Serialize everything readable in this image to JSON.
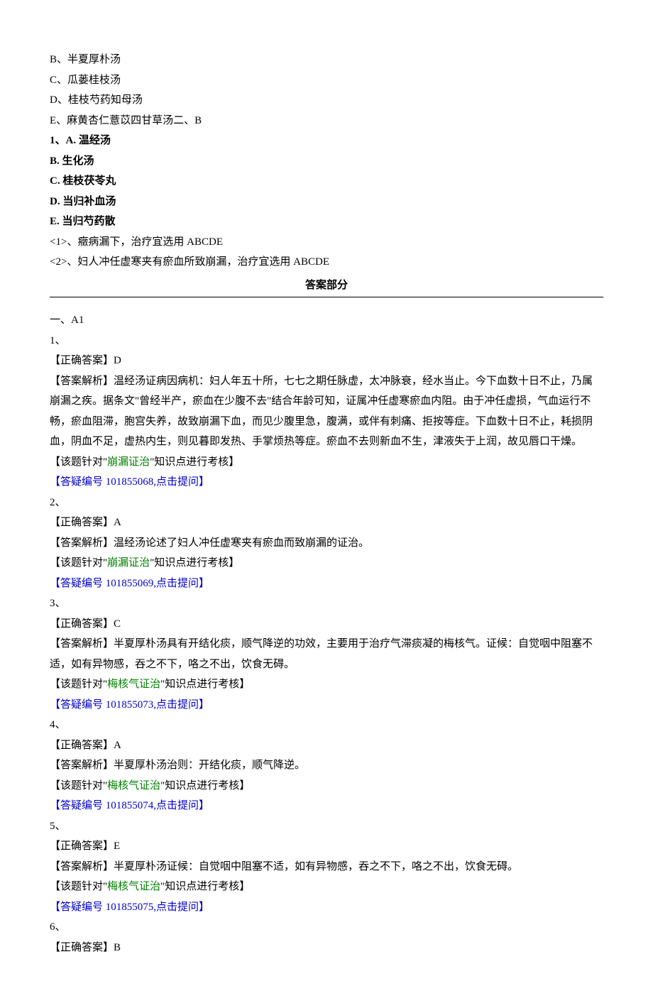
{
  "options_top": {
    "B": "B、半夏厚朴汤",
    "C": "C、瓜蒌桂枝汤",
    "D": "D、桂枝芍药知母汤",
    "E": "E、麻黄杏仁薏苡四甘草汤二、B"
  },
  "q1": {
    "num": "1、A. 温经汤",
    "B": "B. 生化汤",
    "C": "C. 桂枝茯苓丸",
    "D": "D. 当归补血汤",
    "E": "E. 当归芍药散",
    "sub1": "<1>、癥病漏下，治疗宜选用 ABCDE",
    "sub2": "<2>、妇人冲任虚寒夹有瘀血所致崩漏，治疗宜选用 ABCDE"
  },
  "answer_title": "答案部分",
  "section": "一、A1",
  "answers": [
    {
      "num": "1、",
      "correct_label": "【正确答案】",
      "correct_val": "D",
      "analysis_label": "【答案解析】",
      "analysis": "温经汤证病因病机：妇人年五十所，七七之期任脉虚，太冲脉衰，经水当止。今下血数十日不止，乃属崩漏之疾。据条文\"曾经半产，瘀血在少腹不去\"结合年龄可知，证属冲任虚寒瘀血内阻。由于冲任虚损，气血运行不畅，瘀血阻滞，胞宫失养，故致崩漏下血，而见少腹里急，腹满，或伴有刺痛、拒按等症。下血数十日不止，耗损阴血，阴血不足，虚热内生，则见暮即发热、手掌烦热等症。瘀血不去则新血不生，津液失于上润，故见唇口干燥。",
      "point_pre": "【该题针对\"",
      "point_topic": "崩漏证治",
      "point_post": "\"知识点进行考核】",
      "faq_pre": "【答疑编号 ",
      "faq_id": "101855068",
      "faq_post": ",点击提问】"
    },
    {
      "num": "2、",
      "correct_label": "【正确答案】",
      "correct_val": "A",
      "analysis_label": "【答案解析】",
      "analysis": "温经汤论述了妇人冲任虚寒夹有瘀血而致崩漏的证治。",
      "point_pre": "【该题针对\"",
      "point_topic": "崩漏证治",
      "point_post": "\"知识点进行考核】",
      "faq_pre": "【答疑编号 ",
      "faq_id": "101855069",
      "faq_post": ",点击提问】"
    },
    {
      "num": "3、",
      "correct_label": "【正确答案】",
      "correct_val": "C",
      "analysis_label": "【答案解析】",
      "analysis": "半夏厚朴汤具有开结化痰，顺气降逆的功效，主要用于治疗气滞痰凝的梅核气。证候：自觉咽中阻塞不适，如有异物感，吞之不下，咯之不出，饮食无碍。",
      "point_pre": "【该题针对\"",
      "point_topic": "梅核气证治",
      "point_post": "\"知识点进行考核】",
      "faq_pre": "【答疑编号 ",
      "faq_id": "101855073",
      "faq_post": ",点击提问】"
    },
    {
      "num": "4、",
      "correct_label": "【正确答案】",
      "correct_val": "A",
      "analysis_label": "【答案解析】",
      "analysis": "半夏厚朴汤治则：开结化痰，顺气降逆。",
      "point_pre": "【该题针对\"",
      "point_topic": "梅核气证治",
      "point_post": "\"知识点进行考核】",
      "faq_pre": "【答疑编号 ",
      "faq_id": "101855074",
      "faq_post": ",点击提问】"
    },
    {
      "num": "5、",
      "correct_label": "【正确答案】",
      "correct_val": "E",
      "analysis_label": "【答案解析】",
      "analysis": "半夏厚朴汤证候：自觉咽中阻塞不适，如有异物感，吞之不下，咯之不出，饮食无碍。",
      "point_pre": "【该题针对\"",
      "point_topic": "梅核气证治",
      "point_post": "\"知识点进行考核】",
      "faq_pre": "【答疑编号 ",
      "faq_id": "101855075",
      "faq_post": ",点击提问】"
    },
    {
      "num": "6、",
      "correct_label": "【正确答案】",
      "correct_val": "B",
      "analysis_label": "",
      "analysis": "",
      "point_pre": "",
      "point_topic": "",
      "point_post": "",
      "faq_pre": "",
      "faq_id": "",
      "faq_post": ""
    }
  ]
}
